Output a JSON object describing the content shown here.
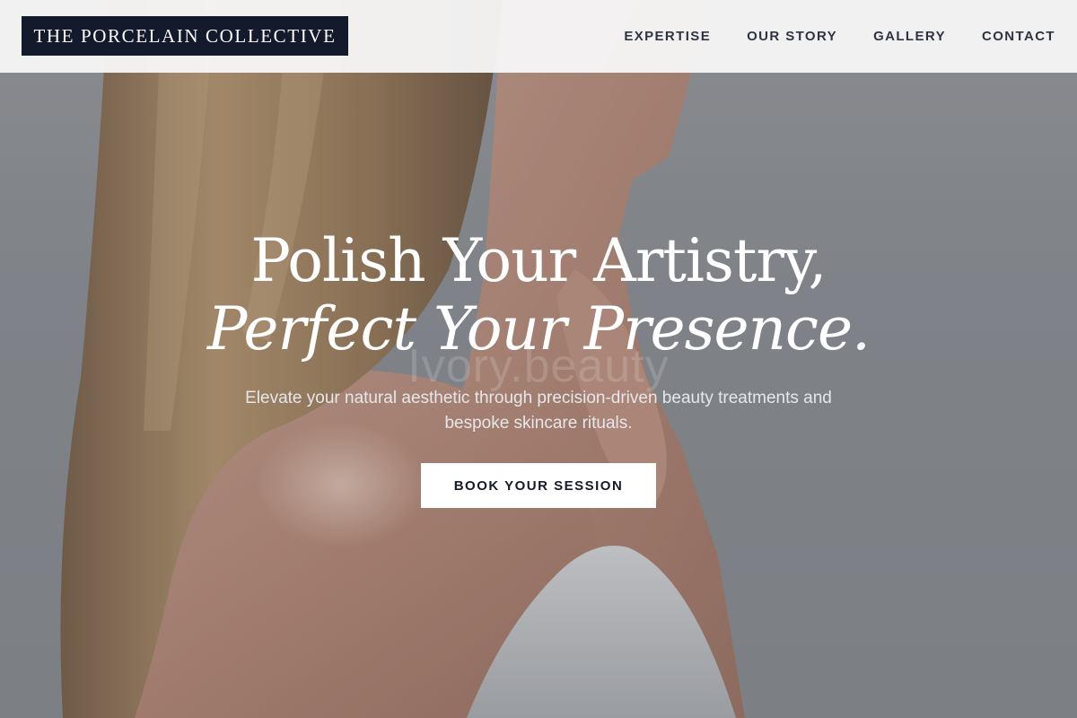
{
  "header": {
    "brand": "THE PORCELAIN COLLECTIVE",
    "nav": [
      {
        "label": "EXPERTISE"
      },
      {
        "label": "OUR STORY"
      },
      {
        "label": "GALLERY"
      },
      {
        "label": "CONTACT"
      }
    ]
  },
  "hero": {
    "headline_line1": "Polish Your Artistry,",
    "headline_line2": "Perfect Your Presence.",
    "watermark": "Ivory.beauty",
    "subtext": "Elevate your natural aesthetic through precision-driven beauty treatments and bespoke skincare rituals.",
    "cta_label": "BOOK YOUR SESSION"
  },
  "colors": {
    "brand_background": "#131a2b",
    "nav_text": "#2f3442",
    "cta_background": "#ffffff",
    "cta_text": "#131a2b"
  }
}
